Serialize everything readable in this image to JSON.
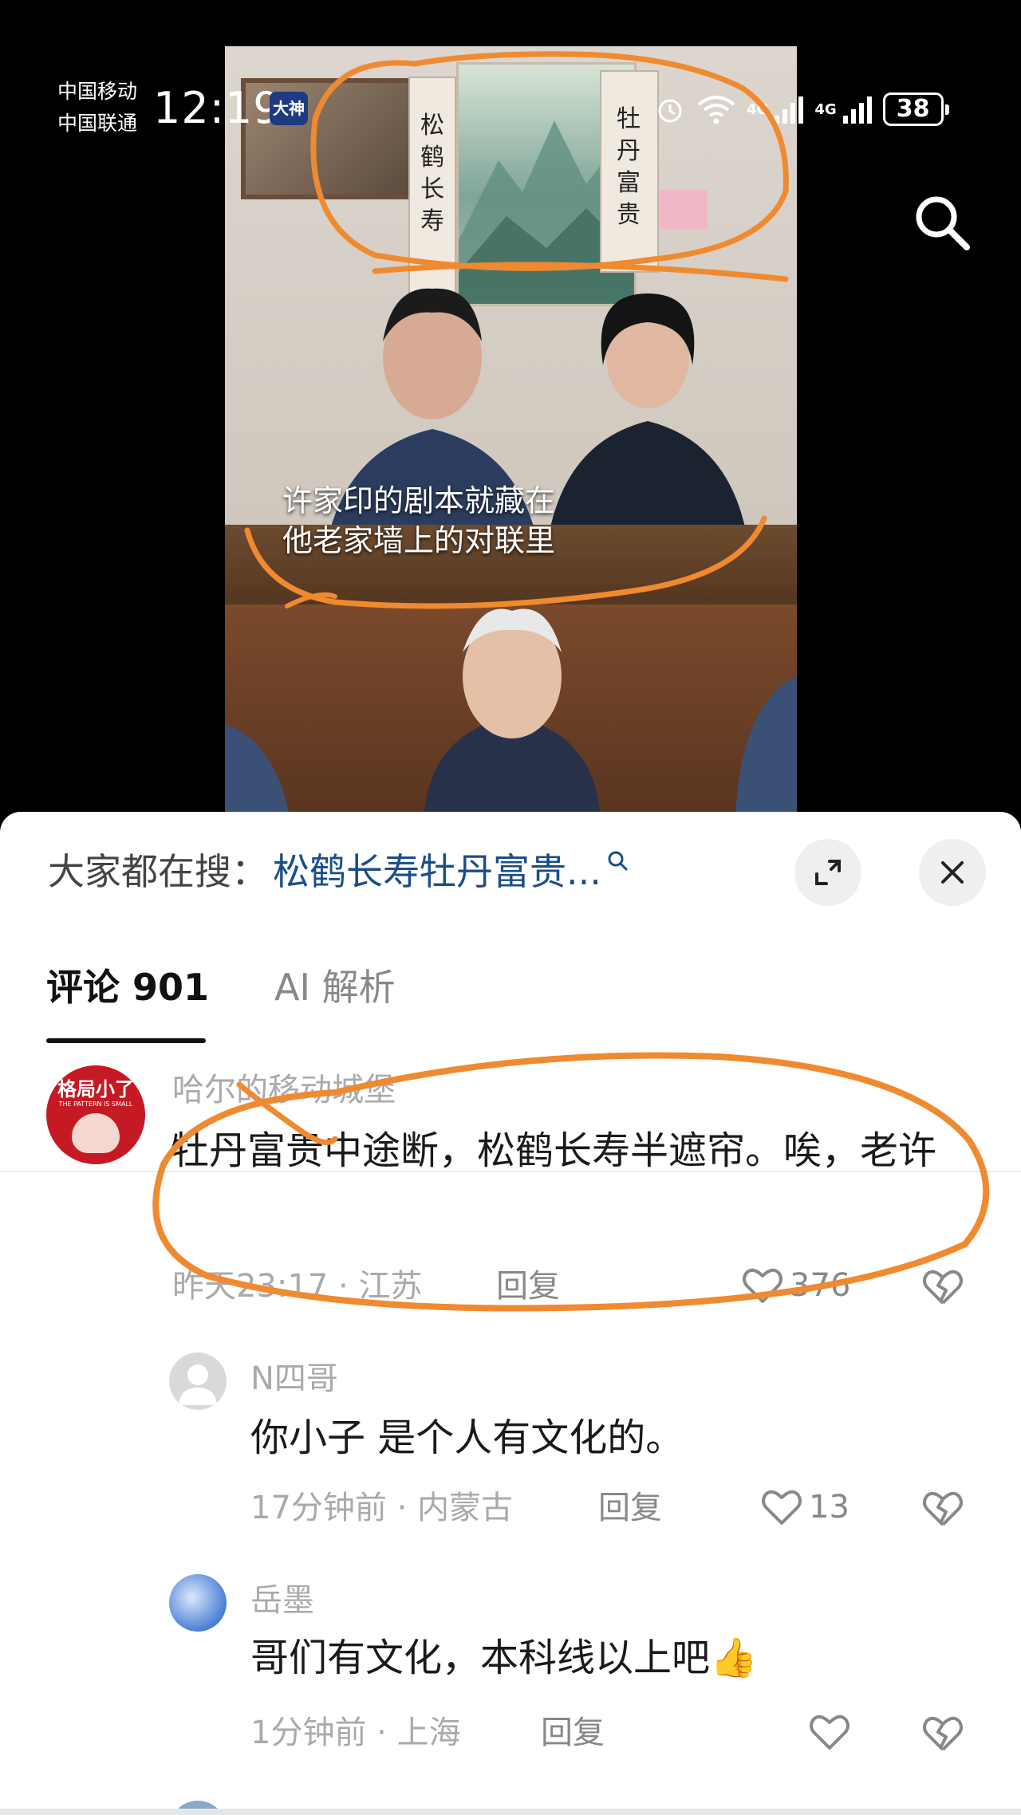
{
  "status_bar": {
    "carrier_1": "中国移动",
    "carrier_2": "中国联通",
    "time": "12:19",
    "app_badge": "大神",
    "network_1": "4G",
    "network_2": "4G",
    "battery": "38"
  },
  "video": {
    "subtitle_line_1": "许家印的剧本就藏在",
    "subtitle_line_2": "他老家墙上的对联里",
    "couplet_left": "松鹤长寿",
    "couplet_right": "牡丹富贵"
  },
  "sheet": {
    "hot_search_prefix": "大家都在搜：",
    "hot_search_query": "松鹤长寿牡丹富贵...",
    "tabs": [
      {
        "label": "评论 901",
        "active": true
      },
      {
        "label": "AI 解析",
        "active": false
      }
    ]
  },
  "comments": [
    {
      "avatar_text": "格局小了",
      "avatar_subtext": "THE PATTERN IS SMALL",
      "username": "哈尔的移动城堡",
      "text": "牡丹富贵中途断，松鹤长寿半遮帘。唉，老许",
      "time": "昨天23:17",
      "location": "江苏",
      "reply_label": "回复",
      "likes": "376"
    },
    {
      "username": "N四哥",
      "text": "你小子 是个人有文化的。",
      "time": "17分钟前",
      "location": "内蒙古",
      "reply_label": "回复",
      "likes": "13"
    },
    {
      "username": "岳墨",
      "text": "哥们有文化，本科线以上吧👍",
      "time": "1分钟前",
      "location": "上海",
      "reply_label": "回复",
      "likes": ""
    }
  ],
  "colors": {
    "hot_query": "#1a4e88",
    "annotation": "#f08a30",
    "avatar_brand": "#c51a24"
  }
}
